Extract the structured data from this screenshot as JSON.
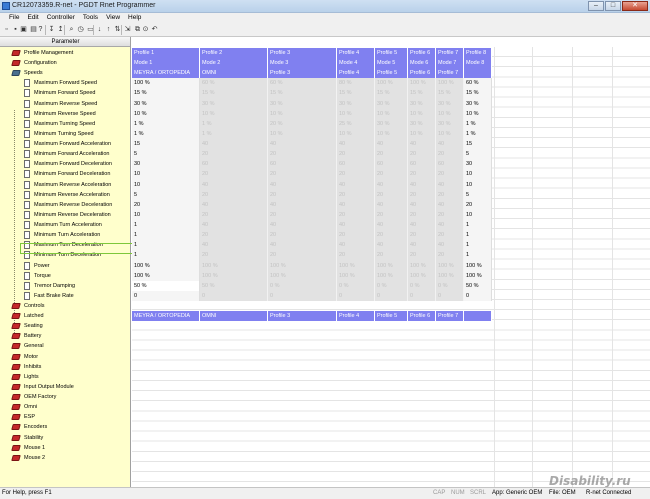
{
  "window": {
    "title": "CR12073359.R-net - PGDT Rnet Programmer",
    "buttons": {
      "minimize": "–",
      "maximize": "□",
      "close": "✕"
    }
  },
  "menu": [
    "File",
    "Edit",
    "Controller",
    "Tools",
    "View",
    "Help"
  ],
  "toolbar": {
    "icons": [
      "new-icon",
      "open-icon",
      "save-icon",
      "print-icon",
      "help-icon",
      "read-icon",
      "write-icon",
      "search-icon",
      "clock-icon",
      "monitor-icon",
      "down-arrow-icon",
      "up-arrow-icon",
      "arrows-icon",
      "import-icon",
      "compare-icon",
      "binoculars-icon",
      "undo-icon"
    ],
    "glyphs": [
      "▫",
      "▪",
      "▣",
      "▤",
      "?",
      "↧",
      "↥",
      "⌕",
      "◷",
      "▭",
      "↓",
      "↑",
      "⇅",
      "⇲",
      "⧉",
      "⊙",
      "↶"
    ]
  },
  "left_panel": {
    "header": "Parameter",
    "items": [
      {
        "label": "Profile Management",
        "type": "folder"
      },
      {
        "label": "Configuration",
        "type": "folder"
      },
      {
        "label": "Speeds",
        "type": "folder-open"
      },
      {
        "label": "Maximum Forward Speed",
        "type": "doc"
      },
      {
        "label": "Minimum Forward Speed",
        "type": "doc"
      },
      {
        "label": "Maximum Reverse Speed",
        "type": "doc"
      },
      {
        "label": "Minimum Reverse Speed",
        "type": "doc"
      },
      {
        "label": "Maximum Turning Speed",
        "type": "doc"
      },
      {
        "label": "Minimum Turning Speed",
        "type": "doc"
      },
      {
        "label": "Maximum Forward Acceleration",
        "type": "doc"
      },
      {
        "label": "Minimum Forward Acceleration",
        "type": "doc"
      },
      {
        "label": "Maximum Forward Deceleration",
        "type": "doc"
      },
      {
        "label": "Minimum Forward Deceleration",
        "type": "doc"
      },
      {
        "label": "Maximum Reverse Acceleration",
        "type": "doc"
      },
      {
        "label": "Minimum Reverse Acceleration",
        "type": "doc"
      },
      {
        "label": "Maximum Reverse Deceleration",
        "type": "doc"
      },
      {
        "label": "Minimum Reverse Deceleration",
        "type": "doc"
      },
      {
        "label": "Maximum Turn Acceleration",
        "type": "doc"
      },
      {
        "label": "Minimum Turn Acceleration",
        "type": "doc"
      },
      {
        "label": "Maximum Turn Deceleration",
        "type": "doc"
      },
      {
        "label": "Minimum Turn Deceleration",
        "type": "doc"
      },
      {
        "label": "Power",
        "type": "doc"
      },
      {
        "label": "Torque",
        "type": "doc"
      },
      {
        "label": "Tremor Damping",
        "type": "doc",
        "selected": true
      },
      {
        "label": "Fast Brake Rate",
        "type": "doc"
      },
      {
        "label": "Controls",
        "type": "folder"
      },
      {
        "label": "Latched",
        "type": "folder"
      },
      {
        "label": "Seating",
        "type": "folder"
      },
      {
        "label": "Battery",
        "type": "folder"
      },
      {
        "label": "General",
        "type": "folder"
      },
      {
        "label": "Motor",
        "type": "folder"
      },
      {
        "label": "Inhibits",
        "type": "folder"
      },
      {
        "label": "Lights",
        "type": "folder"
      },
      {
        "label": "Input Output Module",
        "type": "folder"
      },
      {
        "label": "OEM Factory",
        "type": "folder"
      },
      {
        "label": "Omni",
        "type": "folder"
      },
      {
        "label": "ESP",
        "type": "folder"
      },
      {
        "label": "Encoders",
        "type": "folder"
      },
      {
        "label": "Stability",
        "type": "folder"
      },
      {
        "label": "Mouse 1",
        "type": "folder"
      },
      {
        "label": "Mouse 2",
        "type": "folder"
      }
    ]
  },
  "grid": {
    "profile_row": [
      "Profile 1",
      "Profile 2",
      "Profile 3",
      "Profile 4",
      "Profile 5",
      "Profile 6",
      "Profile 7",
      "Profile 8"
    ],
    "mode_row": [
      "Mode 1",
      "Mode 2",
      "Mode 3",
      "Mode 4",
      "Mode 5",
      "Mode 6",
      "Mode 7",
      "Mode 8"
    ],
    "speeds_row": [
      "MEYRA / ORTOPEDIA",
      "OMNI",
      "Profile 3",
      "Profile 4",
      "Profile 5",
      "Profile 6",
      "Profile 7",
      ""
    ],
    "controls_row": [
      "MEYRA / ORTOPEDIA",
      "OMNI",
      "Profile 3",
      "Profile 4",
      "Profile 5",
      "Profile 6",
      "Profile 7",
      ""
    ],
    "values": [
      [
        "100 %",
        "60 %",
        "60 %",
        "80 %",
        "100 %",
        "100 %",
        "100 %",
        "60 %"
      ],
      [
        "15 %",
        "15 %",
        "15 %",
        "15 %",
        "15 %",
        "15 %",
        "15 %",
        "15 %"
      ],
      [
        "30 %",
        "30 %",
        "30 %",
        "30 %",
        "30 %",
        "30 %",
        "30 %",
        "30 %"
      ],
      [
        "10 %",
        "10 %",
        "10 %",
        "10 %",
        "10 %",
        "10 %",
        "10 %",
        "10 %"
      ],
      [
        "1 %",
        "1 %",
        "20 %",
        "25 %",
        "30 %",
        "30 %",
        "30 %",
        "1 %"
      ],
      [
        "1 %",
        "1 %",
        "10 %",
        "10 %",
        "10 %",
        "10 %",
        "10 %",
        "1 %"
      ],
      [
        "15",
        "40",
        "40",
        "40",
        "40",
        "40",
        "40",
        "15"
      ],
      [
        "5",
        "20",
        "20",
        "20",
        "20",
        "20",
        "20",
        "5"
      ],
      [
        "30",
        "60",
        "60",
        "60",
        "60",
        "60",
        "60",
        "30"
      ],
      [
        "10",
        "20",
        "20",
        "20",
        "20",
        "20",
        "20",
        "10"
      ],
      [
        "10",
        "40",
        "40",
        "40",
        "40",
        "40",
        "40",
        "10"
      ],
      [
        "5",
        "20",
        "20",
        "20",
        "20",
        "20",
        "20",
        "5"
      ],
      [
        "20",
        "40",
        "40",
        "40",
        "40",
        "40",
        "40",
        "20"
      ],
      [
        "10",
        "20",
        "20",
        "20",
        "20",
        "20",
        "20",
        "10"
      ],
      [
        "1",
        "40",
        "40",
        "40",
        "40",
        "40",
        "40",
        "1"
      ],
      [
        "1",
        "20",
        "20",
        "20",
        "20",
        "20",
        "20",
        "1"
      ],
      [
        "1",
        "40",
        "40",
        "40",
        "40",
        "40",
        "40",
        "1"
      ],
      [
        "1",
        "20",
        "20",
        "20",
        "20",
        "20",
        "20",
        "1"
      ],
      [
        "100 %",
        "100 %",
        "100 %",
        "100 %",
        "100 %",
        "100 %",
        "100 %",
        "100 %"
      ],
      [
        "100 %",
        "100 %",
        "100 %",
        "100 %",
        "100 %",
        "100 %",
        "100 %",
        "100 %"
      ],
      [
        "50 %",
        "50 %",
        "0 %",
        "0 %",
        "0 %",
        "0 %",
        "0 %",
        "50 %"
      ],
      [
        "0",
        "0",
        "0",
        "0",
        "0",
        "0",
        "0",
        "0"
      ]
    ]
  },
  "watermark": "Disability.ru",
  "statusbar": {
    "help": "For Help, press F1",
    "cap": "CAP",
    "num": "NUM",
    "scrl": "SCRL",
    "app": "App: Generic OEM",
    "file": "File: OEM",
    "connection": "R-net Connected"
  }
}
